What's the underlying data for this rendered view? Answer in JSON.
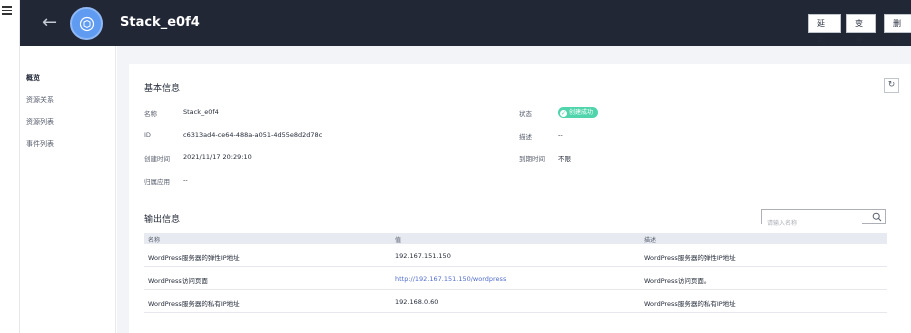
{
  "header": {
    "title": "Stack_e0f4",
    "buttons": {
      "extend": "延期",
      "change": "变更",
      "delete": "删除"
    }
  },
  "sidenav": {
    "items": [
      {
        "label": "概览",
        "active": true
      },
      {
        "label": "资源关系",
        "active": false
      },
      {
        "label": "资源列表",
        "active": false
      },
      {
        "label": "事件列表",
        "active": false
      }
    ]
  },
  "basic": {
    "title": "基本信息",
    "name_label": "名称",
    "name_value": "Stack_e0f4",
    "id_label": "ID",
    "id_value": "c6313ad4-ce64-488a-a051-4d55e8d2d78c",
    "created_label": "创建时间",
    "created_value": "2021/11/17 20:29:10",
    "app_label": "归属应用",
    "app_value": "--",
    "status_label": "状态",
    "status_value": "创建成功",
    "desc_label": "描述",
    "desc_value": "--",
    "expire_label": "到期时间",
    "expire_value": "不限"
  },
  "outputs": {
    "title": "输出信息",
    "search_placeholder": "请输入名称",
    "columns": [
      "名称",
      "值",
      "描述"
    ],
    "rows": [
      {
        "name": "WordPress服务器的弹性IP地址",
        "value": "192.167.151.150",
        "desc": "WordPress服务器的弹性IP地址"
      },
      {
        "name": "WordPress访问页面",
        "value": "http://192.167.151.150/wordpress",
        "desc": "WordPress访问页面。"
      },
      {
        "name": "WordPress服务器的私有IP地址",
        "value": "192.168.0.60",
        "desc": "WordPress服务器的私有IP地址"
      }
    ]
  },
  "colors": {
    "header_bg": "#212735",
    "status_success": "#50d4ab",
    "link": "#526ecc",
    "page_bg": "#f3f4f7"
  }
}
